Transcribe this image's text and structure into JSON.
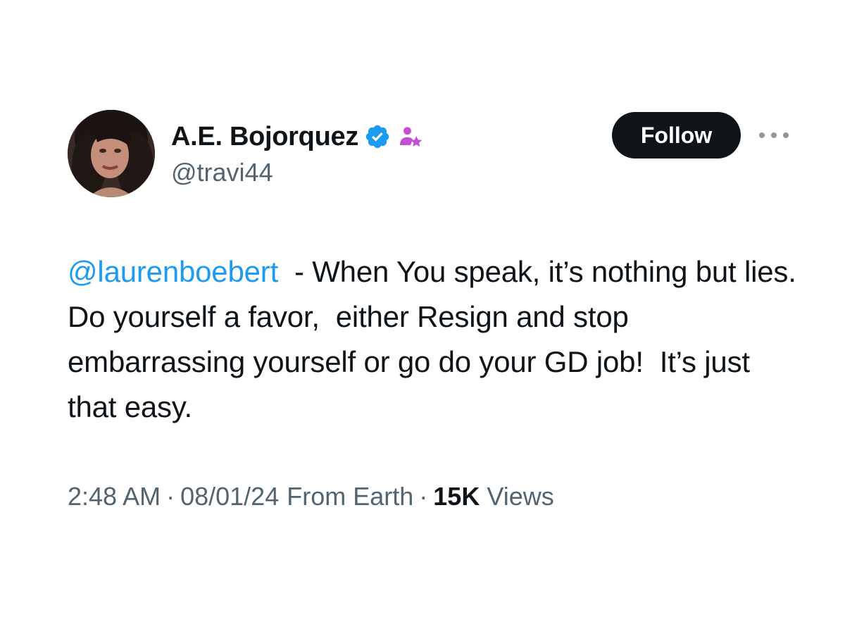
{
  "user": {
    "display_name": "A.E. Bojorquez",
    "handle": "@travi44",
    "avatar_icon": "profile-photo",
    "verified_icon": "verified-badge-icon",
    "affiliate_icon": "affiliate-person-star-icon"
  },
  "actions": {
    "follow_label": "Follow",
    "more_icon": "more-horizontal-icon"
  },
  "tweet": {
    "mention": "@laurenboebert",
    "text": "  - When You speak, it’s nothing but lies.  Do yourself a favor,  either Resign and stop embarrassing yourself or go do your GD job!  It’s just that easy."
  },
  "meta": {
    "time": "2:48 AM",
    "separator": "·",
    "date": "08/01/24",
    "location": "From Earth",
    "views_count": "15K",
    "views_label": "Views"
  },
  "colors": {
    "mention": "#1d9bf0",
    "verified": "#1d9bf0",
    "affiliate": "#c64dd6",
    "secondary_text": "#536471",
    "primary_text": "#0f1419",
    "follow_bg": "#0f1419"
  }
}
